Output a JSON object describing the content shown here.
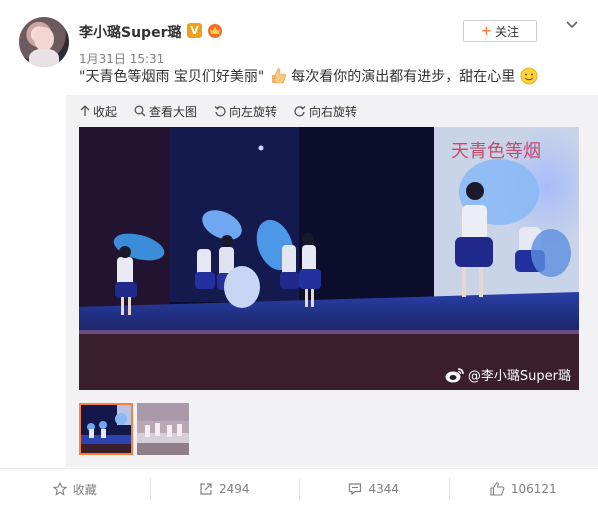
{
  "user": {
    "name": "李小璐Super璐",
    "verified_mark": "V",
    "time": "1月31日 15:31"
  },
  "follow": {
    "plus": "+",
    "label": "关注"
  },
  "post": {
    "text_main": "\"天青色等烟雨   宝贝们好美丽\"",
    "text_rest": "每次看你的演出都有进步，甜在心里"
  },
  "toolbar": {
    "collapse": "收起",
    "view_large": "查看大图",
    "rotate_left": "向左旋转",
    "rotate_right": "向右旋转"
  },
  "image": {
    "watermark": "@李小璐Super璐",
    "banner_text": "天青色等烟"
  },
  "thumbnails": {
    "count": 2,
    "active_index": 0
  },
  "footer": {
    "favorite": "收藏",
    "repost": "2494",
    "comment": "4344",
    "like": "106121"
  },
  "colors": {
    "accent_orange": "#ff8140",
    "thumb_border": "#fa7d3c",
    "verified_badge": "#f0a018",
    "muted_text": "#808080"
  }
}
